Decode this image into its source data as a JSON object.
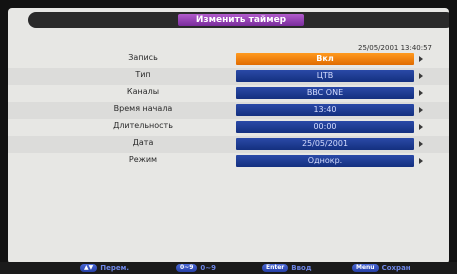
{
  "title": "Изменить таймер",
  "datetime": "25/05/2001 13:40:57",
  "rows": [
    {
      "label": "Запись",
      "value": "Вкл"
    },
    {
      "label": "Тип",
      "value": "ЦТВ"
    },
    {
      "label": "Каналы",
      "value": "BBC ONE"
    },
    {
      "label": "Время начала",
      "value": "13:40"
    },
    {
      "label": "Длительность",
      "value": "00:00"
    },
    {
      "label": "Дата",
      "value": "25/05/2001"
    },
    {
      "label": "Режим",
      "value": "Однокр."
    }
  ],
  "hints": [
    {
      "key": "▲▼",
      "label": "Перем."
    },
    {
      "key": "0~9",
      "label": "0~9"
    },
    {
      "key": "Enter",
      "label": "Ввод"
    },
    {
      "key": "Menu",
      "label": "Сохран"
    }
  ],
  "colors": {
    "accent_active": "#f08010",
    "field_blue": "#1e3c94",
    "title_purple": "#9a44b8"
  }
}
